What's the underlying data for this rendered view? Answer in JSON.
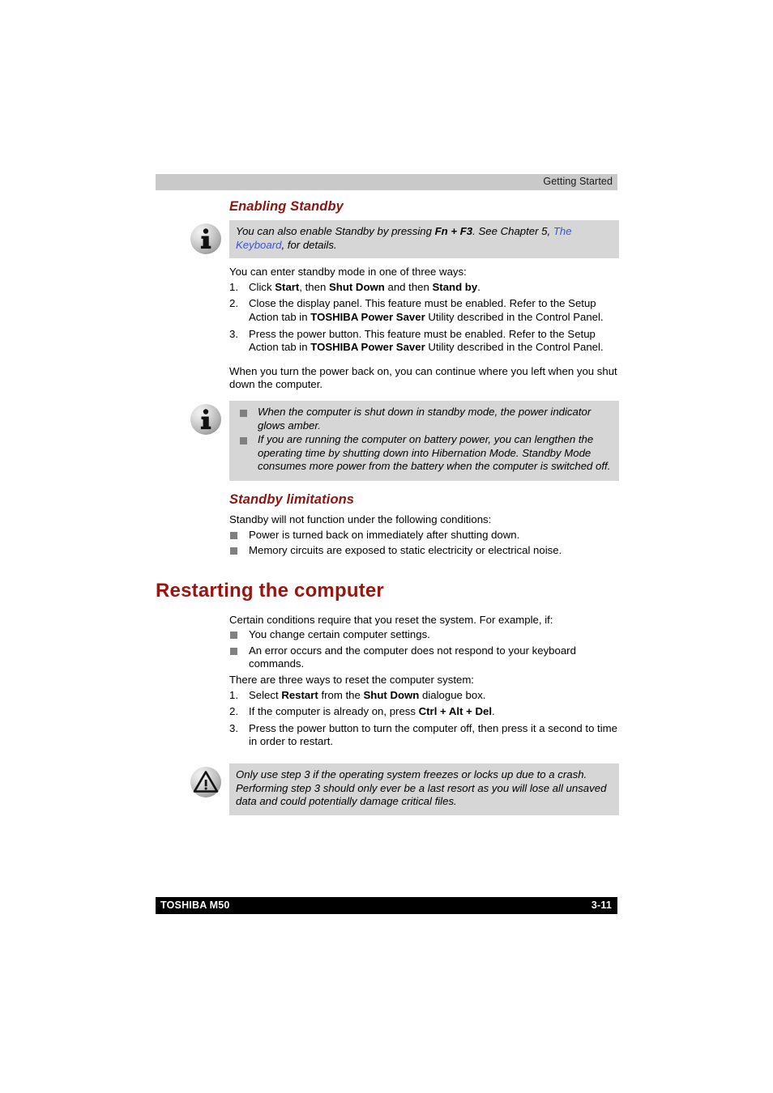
{
  "page": {
    "header_title": "Getting Started",
    "footer_left": "TOSHIBA M50",
    "footer_right": "3-11",
    "colors": {
      "heading_red": "#9a1510",
      "subheading_red": "#8f1410",
      "link_blue": "#3b55d4",
      "note_background": "#d6d6d6",
      "header_background": "#c9c9c9",
      "footer_background": "#000000",
      "bullet_gray": "#808080"
    }
  },
  "sections": {
    "enabling_standby": {
      "heading": "Enabling Standby",
      "note": {
        "icon": "info-icon",
        "text_1": "You can also enable Standby by pressing ",
        "bold_1": "Fn + F3",
        "text_2": ". See Chapter 5, ",
        "link": "The Keyboard",
        "text_3": ", for details."
      },
      "intro": "You can enter standby mode in one of three ways:",
      "steps": [
        {
          "num": "1.",
          "t1": "Click ",
          "b1": "Start",
          "t2": ", then ",
          "b2": "Shut Down",
          "t3": " and then ",
          "b3": "Stand by",
          "t4": "."
        },
        {
          "num": "2.",
          "t1": "Close the display panel. This feature must be enabled. Refer to the Setup Action tab in ",
          "b1": "TOSHIBA Power Saver",
          "t2": " Utility described in the Control Panel.",
          "b2": "",
          "t3": "",
          "b3": "",
          "t4": ""
        },
        {
          "num": "3.",
          "t1": "Press the power button. This feature must be enabled. Refer to the Setup Action tab in ",
          "b1": "TOSHIBA Power Saver",
          "t2": " Utility described in the Control Panel.",
          "b2": "",
          "t3": "",
          "b3": "",
          "t4": ""
        }
      ],
      "outro": "When you turn the power back on, you can continue where you left when you shut down the computer.",
      "note2": {
        "icon": "info-icon",
        "bullets": [
          "When the computer is shut down in standby mode, the power indicator glows amber.",
          "If you are running the computer on battery power, you can lengthen the operating time by shutting down into Hibernation Mode. Standby Mode consumes more power from the battery when the computer is switched off."
        ]
      }
    },
    "standby_limitations": {
      "heading": "Standby limitations",
      "intro": "Standby will not function under the following conditions:",
      "bullets": [
        "Power is turned back on immediately after shutting down.",
        "Memory circuits are exposed to static electricity or electrical noise."
      ]
    },
    "restarting": {
      "heading": "Restarting the computer",
      "intro": "Certain conditions require that you reset the system. For example, if:",
      "bullets": [
        "You change certain computer settings.",
        "An error occurs and the computer does not respond to your keyboard commands."
      ],
      "intro2": "There are three ways to reset the computer system:",
      "steps": [
        {
          "num": "1.",
          "t1": "Select ",
          "b1": "Restart",
          "t2": " from the ",
          "b2": "Shut Down",
          "t3": " dialogue box.",
          "b3": "",
          "t4": ""
        },
        {
          "num": "2.",
          "t1": "If the computer is already on, press ",
          "b1": "Ctrl + Alt + Del",
          "t2": ".",
          "b2": "",
          "t3": "",
          "b3": "",
          "t4": ""
        },
        {
          "num": "3.",
          "t1": "Press the power button to turn the computer off, then press it a second to time in order to restart.",
          "b1": "",
          "t2": "",
          "b2": "",
          "t3": "",
          "b3": "",
          "t4": ""
        }
      ],
      "caution": {
        "icon": "warning-icon",
        "text": "Only use step 3 if the operating system freezes or locks up due to a crash. Performing step 3 should only ever be a last resort as you will lose all unsaved data and could potentially damage critical files."
      }
    }
  }
}
